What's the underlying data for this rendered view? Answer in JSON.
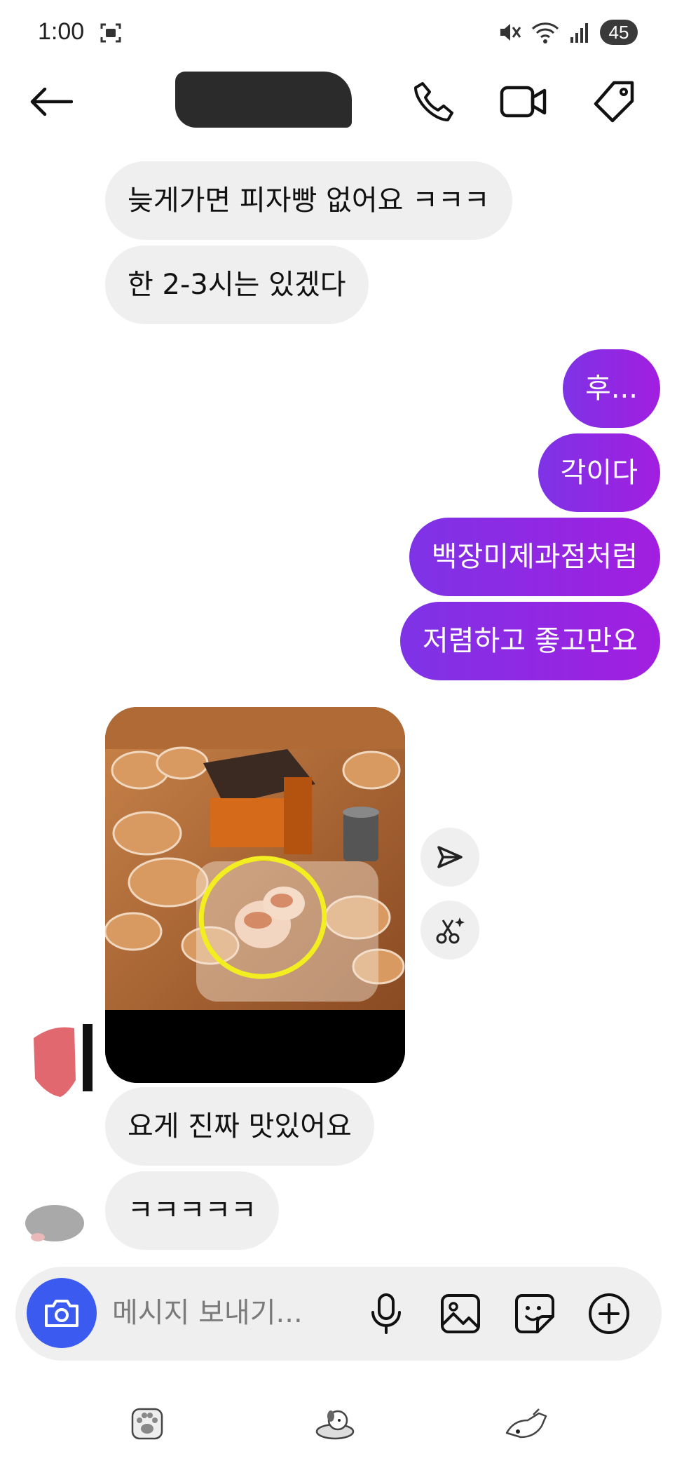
{
  "status_bar": {
    "time": "1:00",
    "battery": "45"
  },
  "header": {
    "back_icon": "arrow-left-icon",
    "call_icon": "phone-icon",
    "video_icon": "video-camera-icon",
    "tag_icon": "tag-icon"
  },
  "messages": {
    "m1": "늦게가면 피자빵 없어요 ㅋㅋㅋ",
    "m2": "한 2-3시는 있겠다",
    "m3": "후...",
    "m4": "각이다",
    "m5": "백장미제과점처럼",
    "m6": "저렴하고 좋고만요",
    "m7": "요게 진짜 맛있어요",
    "m8": "ㅋㅋㅋㅋㅋ"
  },
  "composer": {
    "placeholder": "메시지 보내기..."
  },
  "colors": {
    "outgoing_start": "#7e33e6",
    "outgoing_end": "#a21ee0",
    "incoming": "#efefef",
    "camera": "#3b5bf0"
  }
}
